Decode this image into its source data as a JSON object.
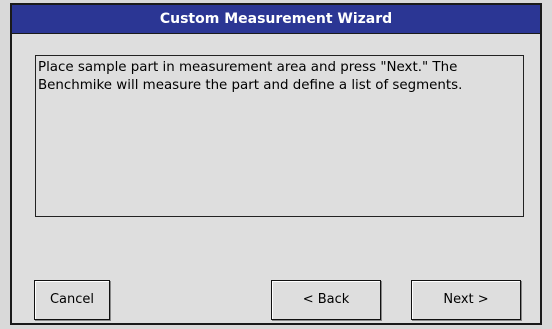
{
  "window": {
    "title": "Custom Measurement Wizard"
  },
  "message": {
    "text": "Place sample part in measurement area and press \"Next.\" The\nBenchmike will measure the part and define a list of segments."
  },
  "buttons": {
    "cancel_label": "Cancel",
    "back_label": "< Back",
    "next_label": "Next >"
  },
  "colors": {
    "titlebar_bg": "#2b3694",
    "window_bg": "#dedede"
  }
}
